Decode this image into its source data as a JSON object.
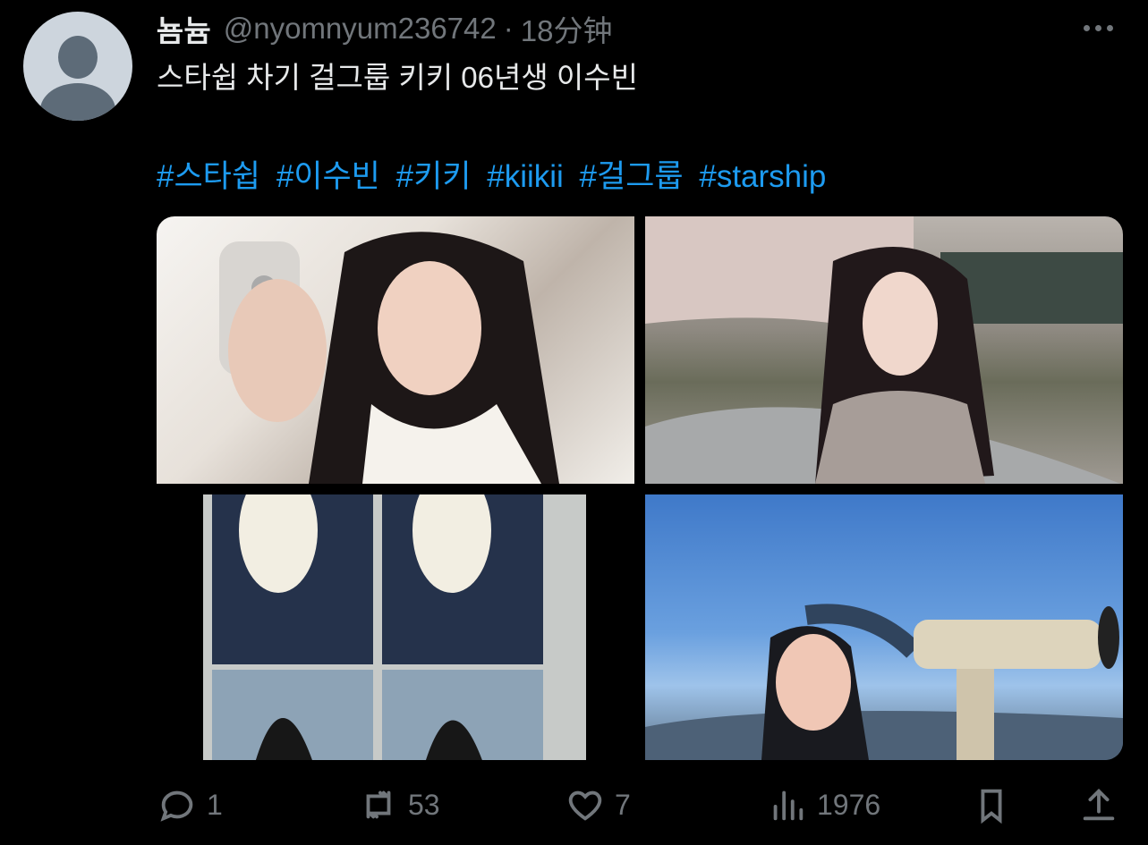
{
  "tweet": {
    "display_name": "뇸늄",
    "handle": "@nyomnyum236742",
    "separator": "·",
    "time": "18分钟",
    "text": "스타쉽 차기 걸그룹 키키 06년생 이수빈",
    "hashtags": [
      "#스타쉽",
      "#이수빈",
      "#키키",
      "#kiikii",
      "#걸그룹",
      "#starship"
    ]
  },
  "icons": {
    "avatar": "default-avatar-icon",
    "more": "more-options-icon"
  },
  "actions": {
    "reply": {
      "icon": "reply-icon",
      "count": "1"
    },
    "retweet": {
      "icon": "retweet-icon",
      "count": "53"
    },
    "like": {
      "icon": "heart-icon",
      "count": "7"
    },
    "views": {
      "icon": "views-bar-icon",
      "count": "1976"
    },
    "bookmark": {
      "icon": "bookmark-icon"
    },
    "share": {
      "icon": "share-icon"
    }
  },
  "media": [
    {
      "name": "media-photo-mirror-selfie"
    },
    {
      "name": "media-photo-cherry-blossom"
    },
    {
      "name": "media-photo-booth-strip"
    },
    {
      "name": "media-photo-telescope"
    }
  ],
  "colors": {
    "background": "#000000",
    "text": "#e7e9ea",
    "muted": "#71767b",
    "link": "#1d9bf0"
  }
}
